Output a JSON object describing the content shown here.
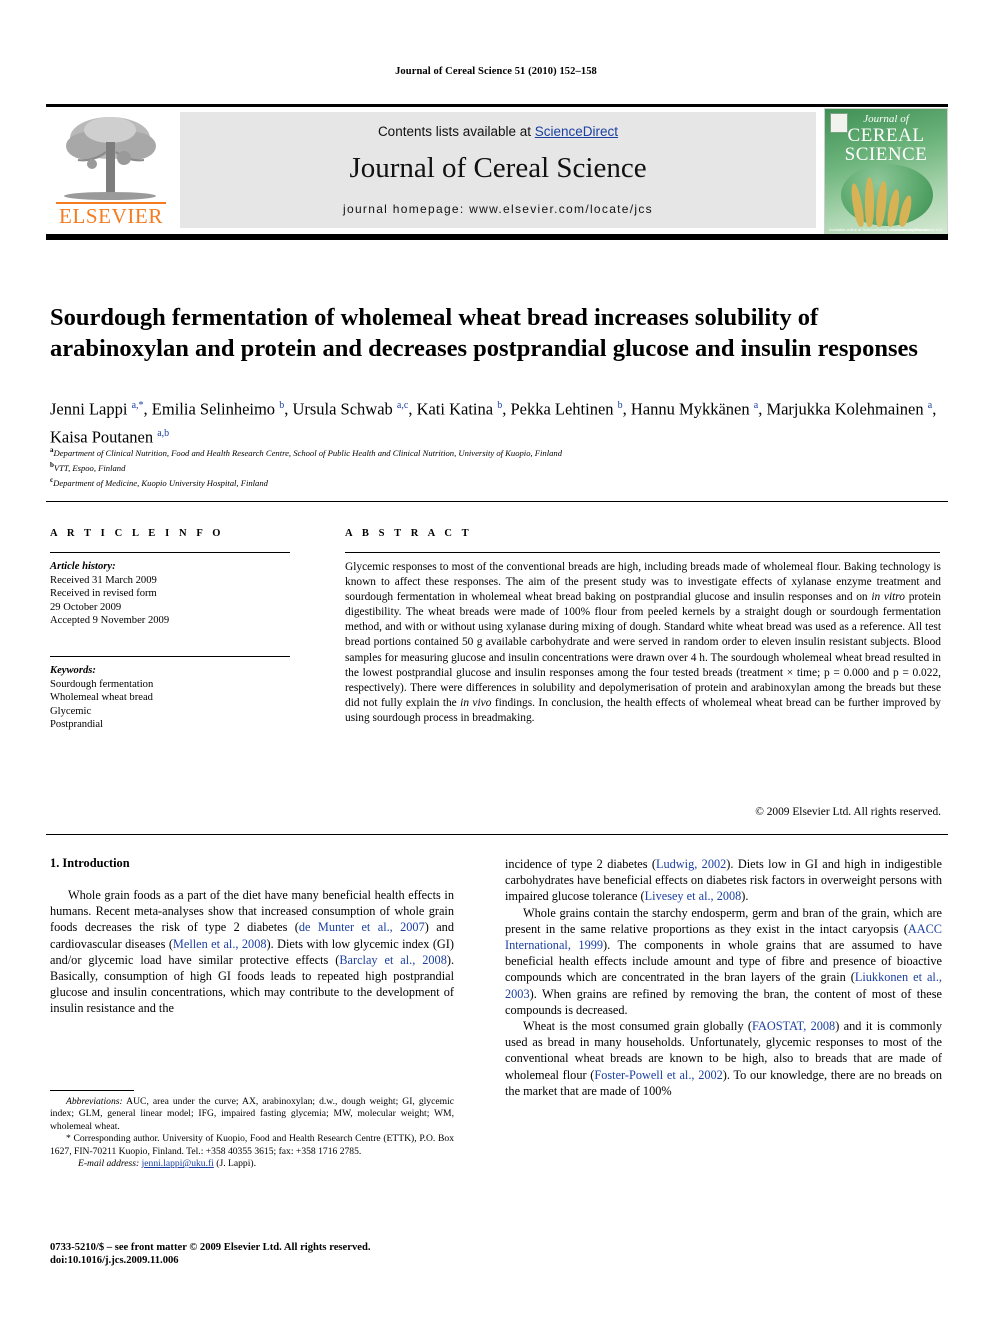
{
  "running_head": "Journal of Cereal Science 51 (2010) 152–158",
  "masthead": {
    "publisher_logo_text": "ELSEVIER",
    "contents_line_prefix": "Contents lists available at ",
    "contents_link": "ScienceDirect",
    "journal_title": "Journal of Cereal Science",
    "homepage": "journal homepage: www.elsevier.com/locate/jcs",
    "cover": {
      "line1": "Journal of",
      "line2": "CEREAL",
      "line3": "SCIENCE",
      "foot_left": "Available online at\nScienceDirect\nwww.sciencedirect.com",
      "foot_right": "Published by Elsevier\nfor ICC"
    }
  },
  "article": {
    "title": "Sourdough fermentation of wholemeal wheat bread increases solubility of arabinoxylan and protein and decreases postprandial glucose and insulin responses",
    "authors_html": "Jenni Lappi <sup>a,*</sup>, Emilia Selinheimo <sup>b</sup>, Ursula Schwab <sup>a,c</sup>, Kati Katina <sup>b</sup>, Pekka Lehtinen <sup>b</sup>, Hannu Mykkänen <sup>a</sup>, Marjukka Kolehmainen <sup>a</sup>, Kaisa Poutanen <sup>a,b</sup>",
    "affiliations": [
      {
        "mark": "a",
        "text": "Department of Clinical Nutrition, Food and Health Research Centre, School of Public Health and Clinical Nutrition, University of Kuopio, Finland"
      },
      {
        "mark": "b",
        "text": "VTT, Espoo, Finland"
      },
      {
        "mark": "c",
        "text": "Department of Medicine, Kuopio University Hospital, Finland"
      }
    ]
  },
  "article_info": {
    "heading": "A R T I C L E  I N F O",
    "history_label": "Article history:",
    "history": [
      "Received 31 March 2009",
      "Received in revised form",
      "29 October 2009",
      "Accepted 9 November 2009"
    ],
    "keywords_label": "Keywords:",
    "keywords": [
      "Sourdough fermentation",
      "Wholemeal wheat bread",
      "Glycemic",
      "Postprandial"
    ]
  },
  "abstract": {
    "heading": "A B S T R A C T",
    "text_html": "Glycemic responses to most of the conventional breads are high, including breads made of wholemeal flour. Baking technology is known to affect these responses. The aim of the present study was to investigate effects of xylanase enzyme treatment and sourdough fermentation in wholemeal wheat bread baking on postprandial glucose and insulin responses and on <span class=\"ital\">in vitro</span> protein digestibility. The wheat breads were made of 100% flour from peeled kernels by a straight dough or sourdough fermentation method, and with or without using xylanase during mixing of dough. Standard white wheat bread was used as a reference. All test bread portions contained 50 g available carbohydrate and were served in random order to eleven insulin resistant subjects. Blood samples for measuring glucose and insulin concentrations were drawn over 4 h. The sourdough wholemeal wheat bread resulted in the lowest postprandial glucose and insulin responses among the four tested breads (treatment × time; p = 0.000 and p = 0.022, respectively). There were differences in solubility and depolymerisation of protein and arabinoxylan among the breads but these did not fully explain the <span class=\"ital\">in vivo</span> findings. In conclusion, the health effects of wholemeal wheat bread can be further improved by using sourdough process in breadmaking.",
    "copyright": "© 2009 Elsevier Ltd. All rights reserved."
  },
  "body": {
    "section_heading": "1. Introduction",
    "left_paragraphs_html": [
      "Whole grain foods as a part of the diet have many beneficial health effects in humans. Recent meta-analyses show that increased consumption of whole grain foods decreases the risk of type 2 diabetes (<span class=\"ref\">de Munter et al., 2007</span>) and cardiovascular diseases (<span class=\"ref\">Mellen et al., 2008</span>). Diets with low glycemic index (GI) and/or glycemic load have similar protective effects (<span class=\"ref\">Barclay et al., 2008</span>). Basically, consumption of high GI foods leads to repeated high postprandial glucose and insulin concentrations, which may contribute to the development of insulin resistance and the"
    ],
    "right_paragraphs_html": [
      "incidence of type 2 diabetes (<span class=\"ref\">Ludwig, 2002</span>). Diets low in GI and high in indigestible carbohydrates have beneficial effects on diabetes risk factors in overweight persons with impaired glucose tolerance (<span class=\"ref\">Livesey et al., 2008</span>).",
      "Whole grains contain the starchy endosperm, germ and bran of the grain, which are present in the same relative proportions as they exist in the intact caryopsis (<span class=\"ref\">AACC International, 1999</span>). The components in whole grains that are assumed to have beneficial health effects include amount and type of fibre and presence of bioactive compounds which are concentrated in the bran layers of the grain (<span class=\"ref\">Liukkonen et al., 2003</span>). When grains are refined by removing the bran, the content of most of these compounds is decreased.",
      "Wheat is the most consumed grain globally (<span class=\"ref\">FAOSTAT, 2008</span>) and it is commonly used as bread in many households. Unfortunately, glycemic responses to most of the conventional wheat breads are known to be high, also to breads that are made of wholemeal flour (<span class=\"ref\">Foster-Powell et al., 2002</span>). To our knowledge, there are no breads on the market that are made of 100%"
    ]
  },
  "footnotes": {
    "abbreviations_html": "<span class=\"fn-ital\">Abbreviations:</span> AUC, area under the curve; AX, arabinoxylan; d.w., dough weight; GI, glycemic index; GLM, general linear model; IFG, impaired fasting glycemia; MW, molecular weight; WM, wholemeal wheat.",
    "corresponding_html": "* Corresponding author. University of Kuopio, Food and Health Research Centre (ETTK), P.O. Box 1627, FIN-70211 Kuopio, Finland. Tel.: +358 40355 3615; fax: +358 1716 2785.",
    "email_label": "E-mail address:",
    "email_address": "jenni.lappi@uku.fi",
    "email_suffix": "(J. Lappi)."
  },
  "imprint": {
    "line1": "0733-5210/$ – see front matter © 2009 Elsevier Ltd. All rights reserved.",
    "line2": "doi:10.1016/j.jcs.2009.11.006"
  }
}
